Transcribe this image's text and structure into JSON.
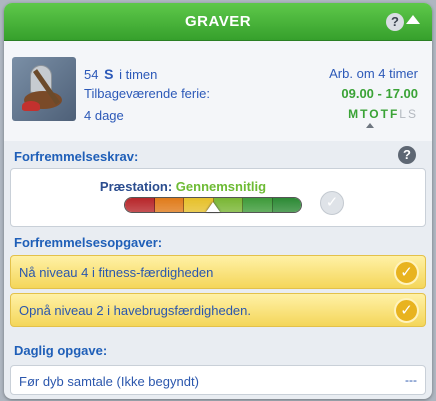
{
  "header": {
    "title": "GRAVER",
    "help_label": "?"
  },
  "career": {
    "icon": "gravedigger-career-icon",
    "pay_amount": "54",
    "currency_symbol": "S",
    "pay_unit": "i timen",
    "vacation_label": "Tilbageværende ferie:",
    "vacation_days": "4 dage",
    "work_in": "Arb. om 4 timer",
    "hours": "09.00 - 17.00",
    "days": [
      {
        "label": "M",
        "work": true
      },
      {
        "label": "T",
        "work": true
      },
      {
        "label": "O",
        "work": true
      },
      {
        "label": "T",
        "work": true
      },
      {
        "label": "F",
        "work": true
      },
      {
        "label": "L",
        "work": false
      },
      {
        "label": "S",
        "work": false
      }
    ],
    "today_index": 3
  },
  "promotion": {
    "section_label": "Forfremmelseskrav:",
    "help_label": "?",
    "performance_label": "Præstation:",
    "performance_value": "Gennemsnitlig",
    "performance_level": 0.5,
    "bar_colors": [
      "#b7262a",
      "#e07b1a",
      "#e6c02a",
      "#79b634",
      "#3e9b3a",
      "#2d8a35"
    ]
  },
  "promotion_tasks": {
    "section_label": "Forfremmelsesopgaver:",
    "items": [
      {
        "text": "Nå niveau 4 i fitness-færdigheden",
        "done": true
      },
      {
        "text": "Opnå niveau 2 i havebrugsfærdigheden.",
        "done": true
      }
    ]
  },
  "daily_task": {
    "section_label": "Daglig opgave:",
    "text": "Før dyb samtale (Ikke begyndt)",
    "status": "---"
  },
  "colors": {
    "accent_green": "#3aa336",
    "text_blue": "#2b57ad",
    "task_yellow": "#f4d65a"
  }
}
